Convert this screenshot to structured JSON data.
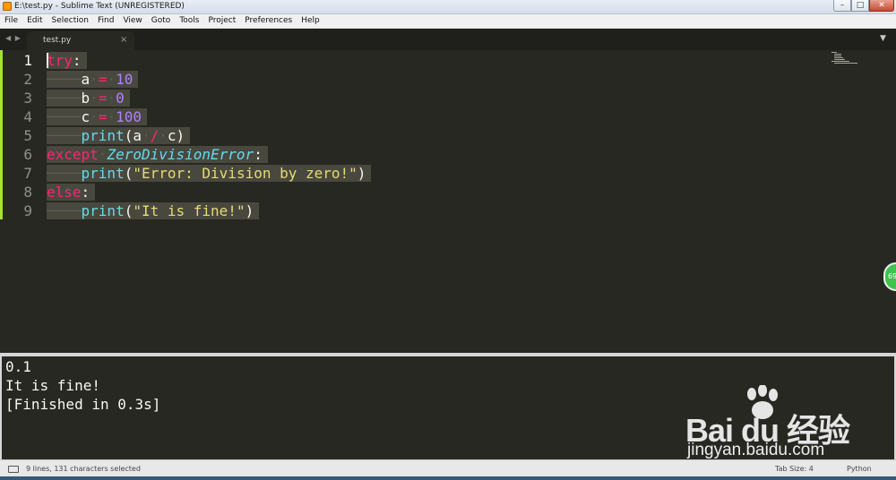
{
  "window": {
    "title": "E:\\test.py - Sublime Text (UNREGISTERED)",
    "min": "–",
    "max": "□",
    "close": "✕"
  },
  "menu": [
    "File",
    "Edit",
    "Selection",
    "Find",
    "View",
    "Goto",
    "Tools",
    "Project",
    "Preferences",
    "Help"
  ],
  "tabs": {
    "nav": "◀ ▶",
    "active_tab": "test.py",
    "close": "×",
    "dropdown": "▼"
  },
  "editor": {
    "line_numbers": [
      "1",
      "2",
      "3",
      "4",
      "5",
      "6",
      "7",
      "8",
      "9"
    ],
    "current_line": 1,
    "language": "Python",
    "colors": {
      "background": "#272822",
      "keyword": "#f92672",
      "function": "#66d9ef",
      "number": "#ae81ff",
      "string": "#e6db74",
      "selection": "#49483e",
      "gutter_marker": "#a6e22e"
    },
    "code": {
      "l1_kw": "try",
      "l1_colon": ":",
      "l2_var": "a",
      "l2_op": "=",
      "l2_num": "10",
      "l3_var": "b",
      "l3_op": "=",
      "l3_num": "0",
      "l4_var": "c",
      "l4_op": "=",
      "l4_num": "100",
      "l5_fn": "print",
      "l5_open": "(a",
      "l5_op": "/",
      "l5_close": "c)",
      "l6_kw": "except",
      "l6_cls": "ZeroDivisionError",
      "l6_colon": ":",
      "l7_fn": "print",
      "l7_open": "(",
      "l7_str": "\"Error: Division by zero!\"",
      "l7_close": ")",
      "l8_kw": "else",
      "l8_colon": ":",
      "l9_fn": "print",
      "l9_open": "(",
      "l9_str": "\"It is fine!\"",
      "l9_close": ")"
    },
    "scroll_badge": "69"
  },
  "output": {
    "lines": [
      "0.1",
      "It is fine!",
      "[Finished in 0.3s]"
    ]
  },
  "watermark": {
    "brand": "Bai du 经验",
    "url": "jingyan.baidu.com"
  },
  "status": {
    "selection": "9 lines, 131 characters selected",
    "tab_size": "Tab Size: 4",
    "syntax": "Python"
  }
}
